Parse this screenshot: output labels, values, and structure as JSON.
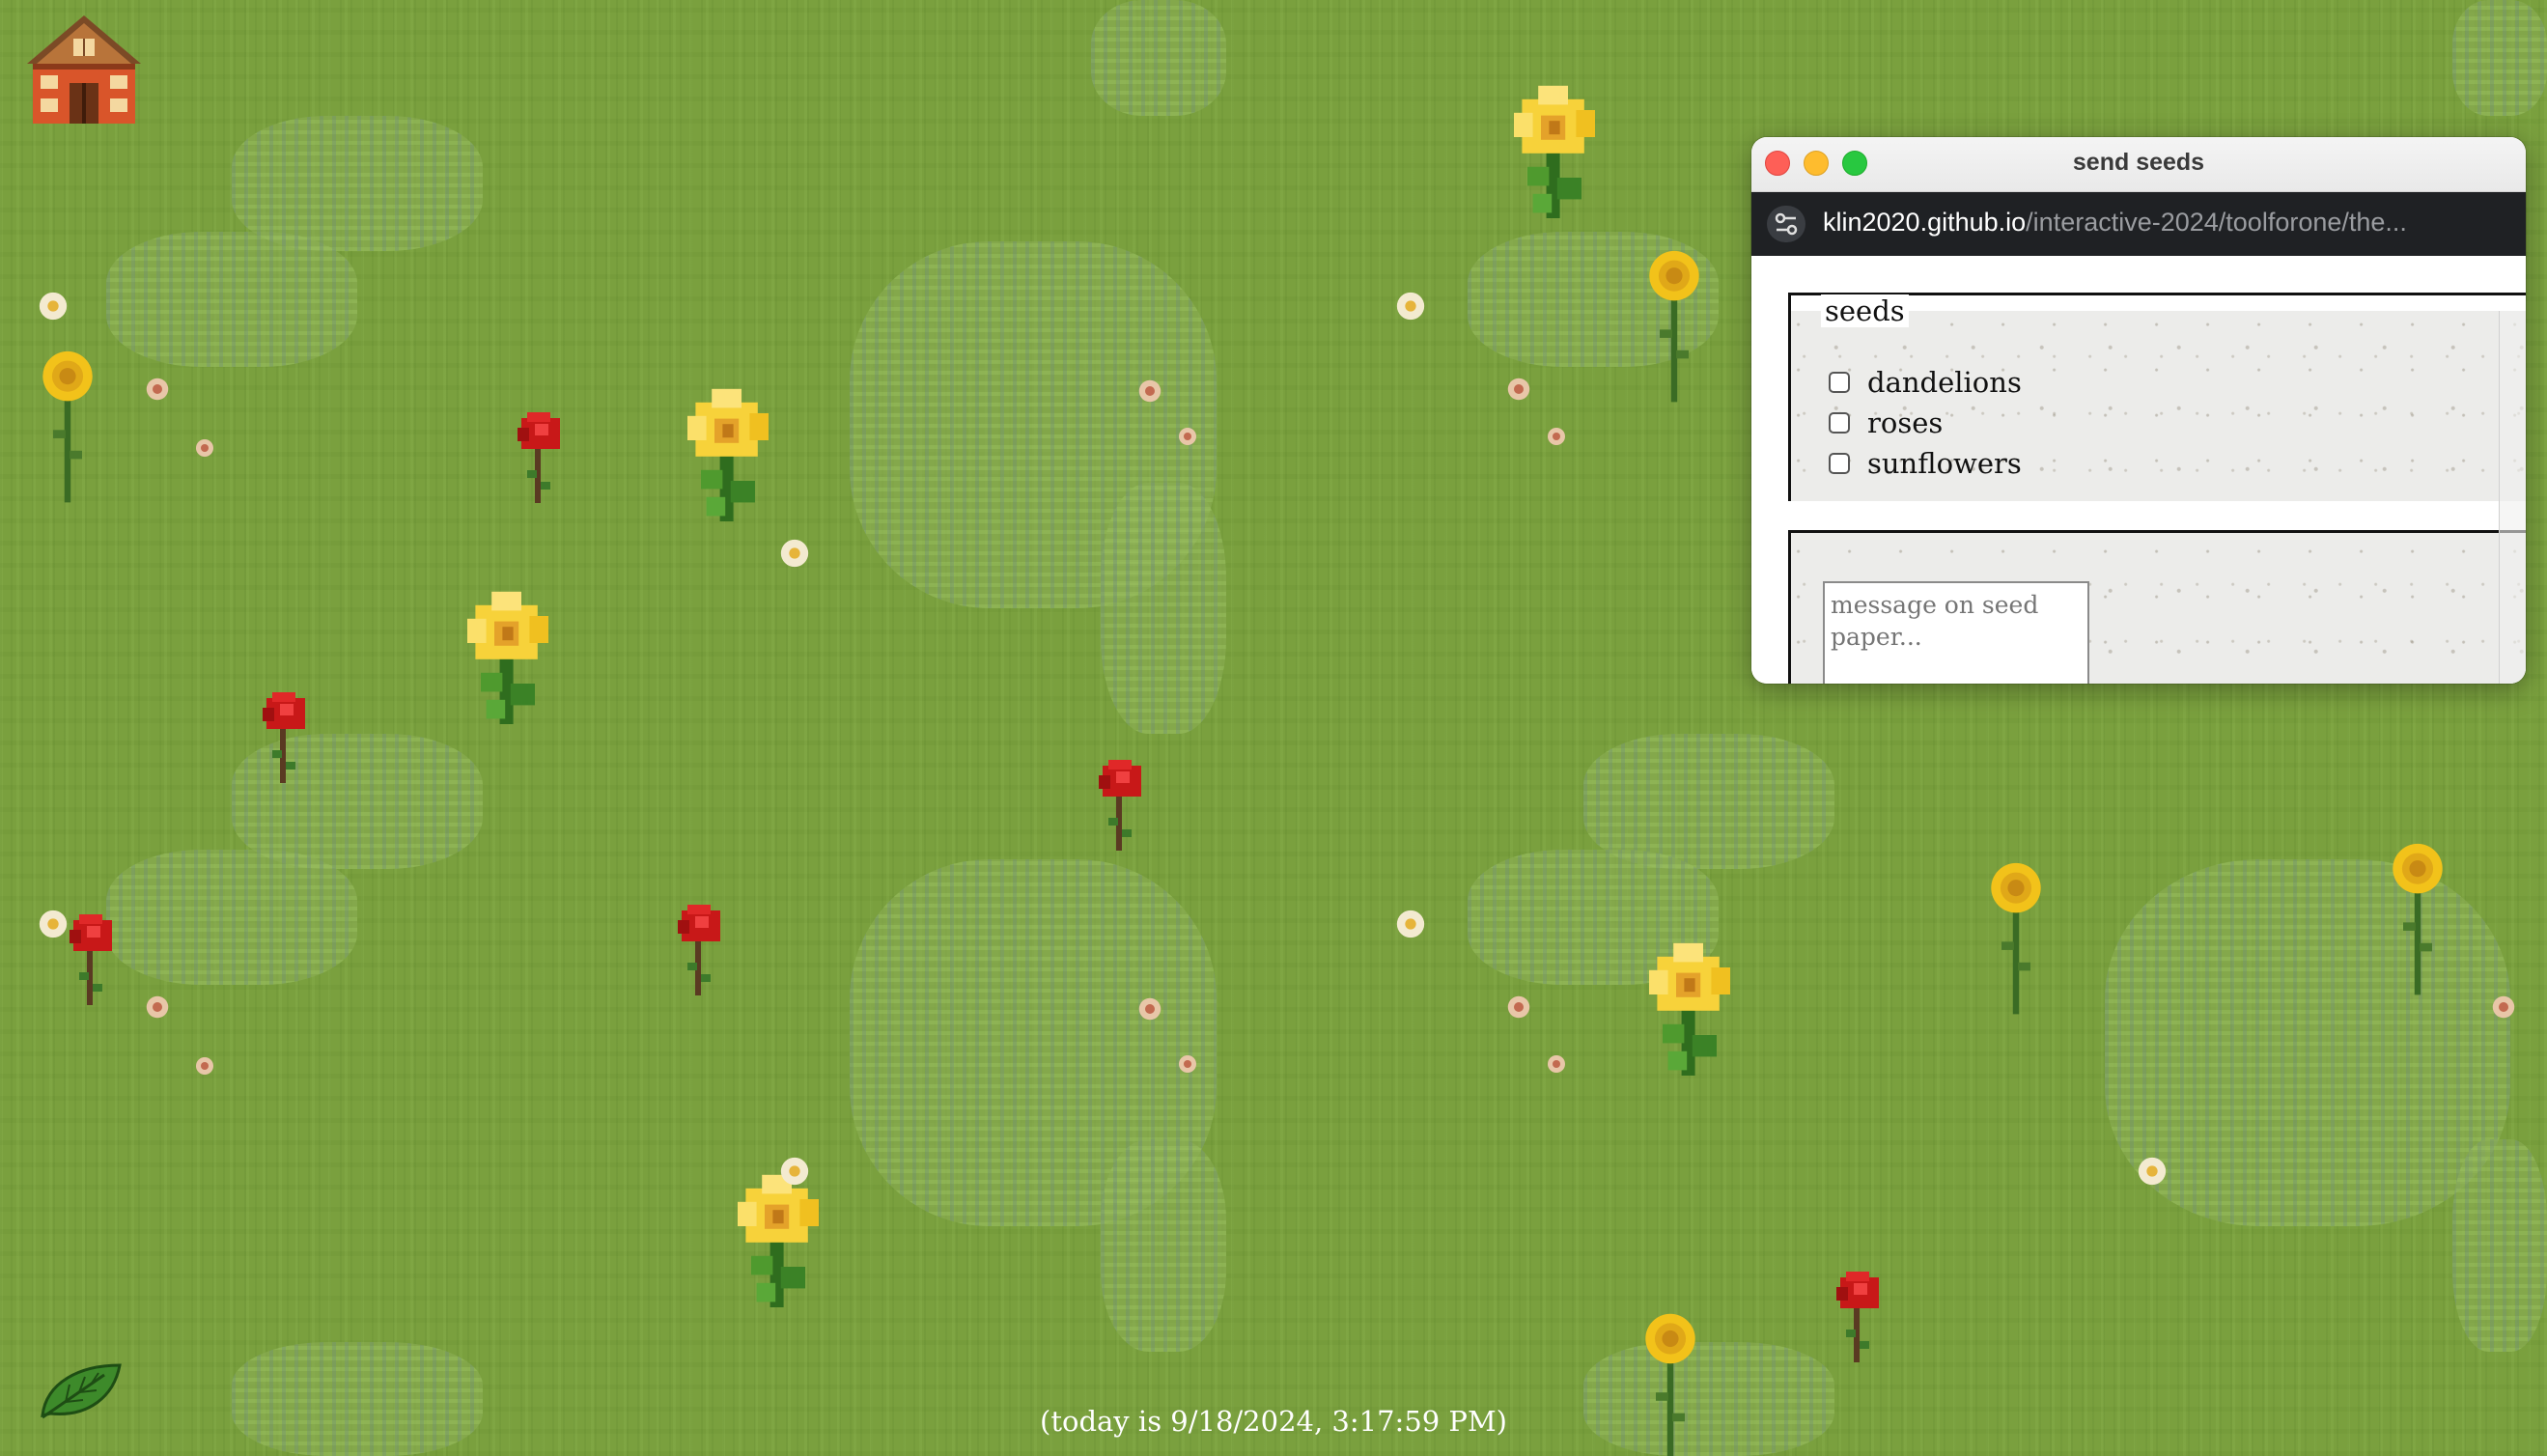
{
  "footer": {
    "date_text": "(today is 9/18/2024, 3:17:59 PM)"
  },
  "icons": {
    "home": "barn-house-icon",
    "leaf": "leaf-icon"
  },
  "popup": {
    "window_title": "send seeds",
    "url_host": "klin2020.github.io",
    "url_path": "/interactive-2024/toolforone/the...",
    "seeds_legend": "seeds",
    "options": [
      {
        "label": "dandelions",
        "checked": false
      },
      {
        "label": "roses",
        "checked": false
      },
      {
        "label": "sunflowers",
        "checked": false
      }
    ],
    "message_placeholder": "message on seed paper..."
  },
  "colors": {
    "grass": "#7aa03e",
    "rose": "#d42020",
    "sunflower": "#f5c518",
    "dandelion": "#f7d23a"
  }
}
